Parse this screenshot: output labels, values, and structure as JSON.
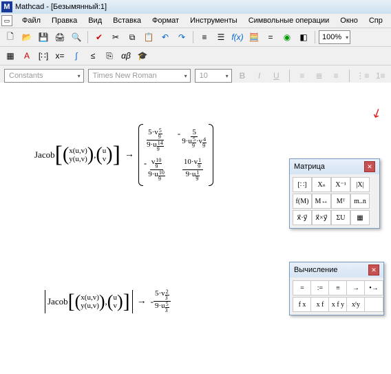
{
  "title": "Mathcad - [Безымянный:1]",
  "app_icon": "M",
  "menus": [
    "Файл",
    "Правка",
    "Вид",
    "Вставка",
    "Формат",
    "Инструменты",
    "Символьные операции",
    "Окно",
    "Спр"
  ],
  "toolbar1": {
    "icons": [
      "new",
      "open",
      "save",
      "print",
      "preview",
      "spell",
      "cut",
      "copy",
      "paste",
      "undo",
      "redo",
      "align",
      "fx",
      "eq",
      "unit",
      "go",
      "zoom"
    ],
    "zoom": "100%"
  },
  "toolbar2": {
    "icons": [
      "calc",
      "matrix",
      "xeq",
      "graph",
      "prog",
      "greek",
      "alpha-beta",
      "cap"
    ]
  },
  "format_bar": {
    "style": "Constants",
    "font": "Times New Roman",
    "size": "10",
    "buttons": [
      "B",
      "I",
      "U"
    ]
  },
  "region1": {
    "label": "Jacob",
    "args": [
      "x(u,v)",
      "y(u,v)",
      "u",
      "v"
    ],
    "arrow": "→",
    "cells": [
      {
        "num_coef": "5·v",
        "num_exp_n": "5",
        "num_exp_d": "9",
        "den_coef": "9·u",
        "den_exp_n": "14",
        "den_exp_d": "9",
        "sign": ""
      },
      {
        "num": "5",
        "den_coef": "9·u",
        "den_exp_n": "5",
        "den_exp_d": "9",
        "den_extra": "·v",
        "den_extra_exp_n": "4",
        "den_extra_exp_d": "9",
        "sign": "-"
      },
      {
        "num_coef": "v",
        "num_exp_n": "10",
        "num_exp_d": "9",
        "den_coef": "9·u",
        "den_exp_n": "10",
        "den_exp_d": "9",
        "sign": "-"
      },
      {
        "num_coef": "10·v",
        "num_exp_n": "1",
        "num_exp_d": "9",
        "den_coef": "9·u",
        "den_exp_n": "1",
        "den_exp_d": "9",
        "sign": ""
      }
    ]
  },
  "region2": {
    "label": "Jacob",
    "args": [
      "x(u,v)",
      "y(u,v)",
      "u",
      "v"
    ],
    "arrow": "→",
    "sign": "-",
    "num_coef": "5·v",
    "num_exp_n": "2",
    "num_exp_d": "3",
    "den_coef": "9·u",
    "den_exp_n": "5",
    "den_exp_d": "3"
  },
  "palette_matrix": {
    "title": "Матрица",
    "icons": [
      "[∷]",
      "Xₙ",
      "X⁻¹",
      "|X|",
      "f(M)",
      "M↔",
      "Mᵀ",
      "m..n",
      "x⃗·y⃗",
      "x⃗×y⃗",
      "ΣU",
      "▦"
    ]
  },
  "palette_calc": {
    "title": "Вычисление",
    "icons": [
      "=",
      ":=",
      "≡",
      "→",
      "•→",
      "f x",
      "x f",
      "x f y",
      "xᶠy",
      ""
    ]
  },
  "arrow_color": "#e02020"
}
